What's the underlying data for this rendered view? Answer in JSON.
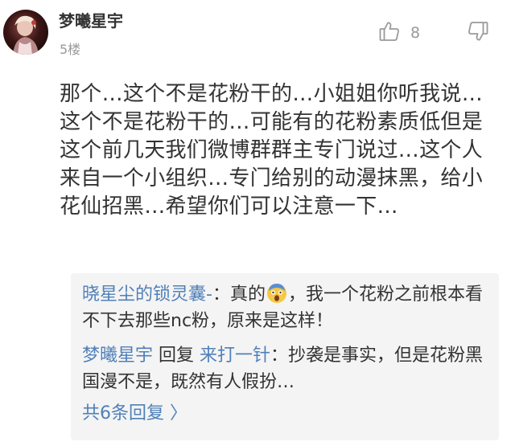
{
  "comment": {
    "username": "梦曦星宇",
    "floor": "5楼",
    "like_count": "8",
    "like_icon": "thumbs-up-icon",
    "dislike_icon": "thumbs-down-icon",
    "text": "那个…这个不是花粉干的…小姐姐你听我说…这个不是花粉干的…可能有的花粉素质低但是这个前几天我们微博群群主专门说过…这个人来自一个小组织…专门给别的动漫抹黑，给小花仙招黑…希望你们可以注意一下…"
  },
  "replies": [
    {
      "author": "晓星尘的锁灵囊-",
      "separator": "：",
      "text_before_emoji": "真的",
      "emoji": "screaming-face-icon",
      "text_after_emoji": "，我一个花粉之前根本看不下去那些nc粉，原来是这样！"
    },
    {
      "author": "梦曦星宇",
      "reply_word": " 回复 ",
      "target": "来打一针",
      "separator": "：",
      "text": "抄袭是事实，但是花粉黑国漫不是，既然有人假扮…"
    }
  ],
  "more_replies_label": "共6条回复 〉",
  "colors": {
    "link_blue": "#5080b8",
    "text": "#333333",
    "meta_gray": "#999999",
    "reply_bg": "#f4f4f4"
  }
}
